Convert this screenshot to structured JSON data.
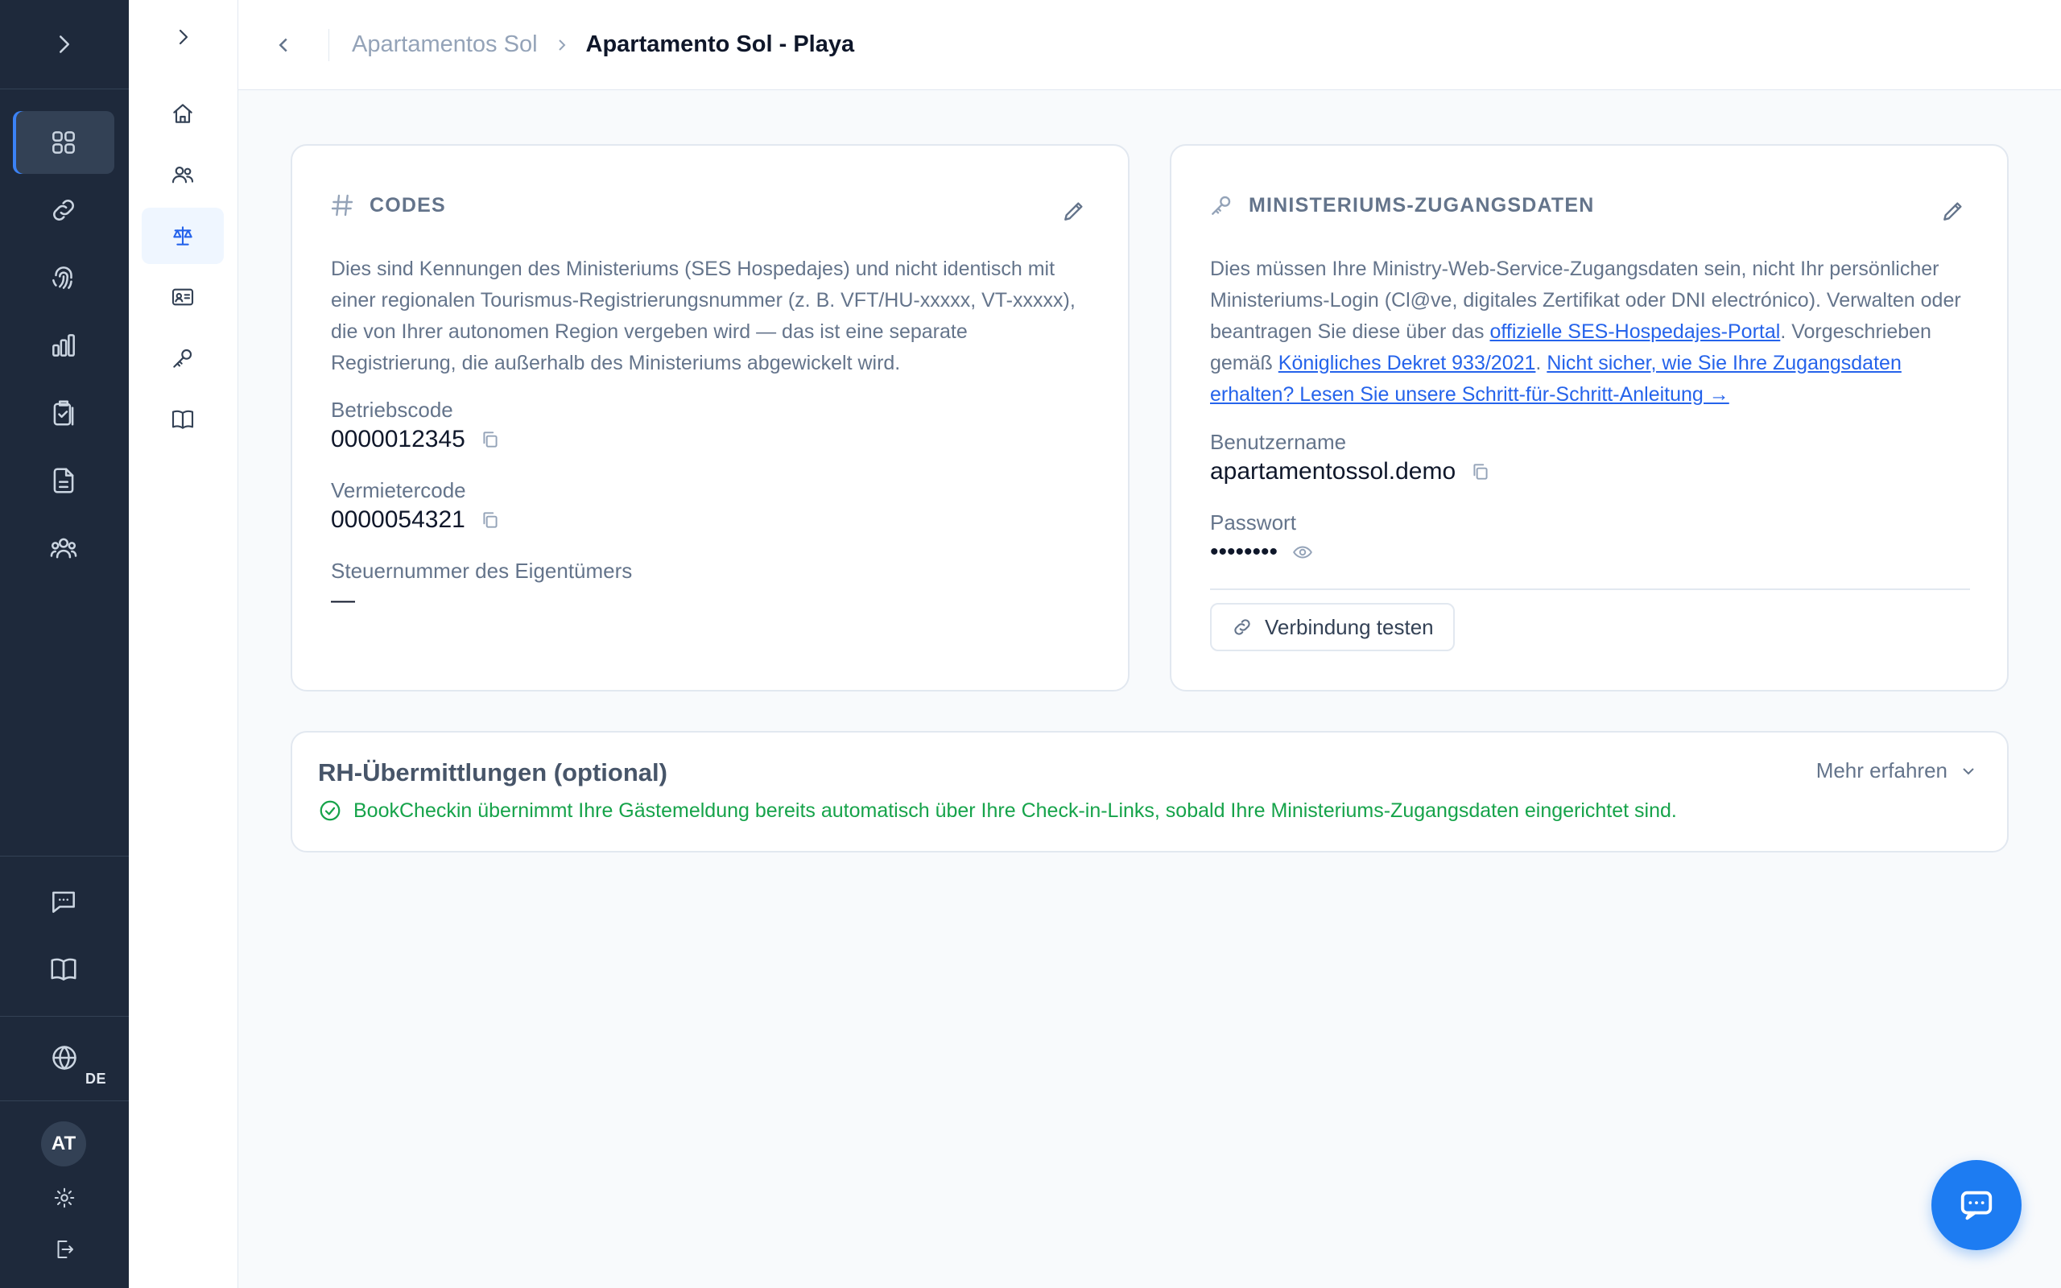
{
  "breadcrumb": {
    "parent": "Apartamentos Sol",
    "current": "Apartamento Sol - Playa"
  },
  "rail": {
    "icons": [
      "chevron-right-icon",
      "dashboard-icon",
      "link-icon",
      "fingerprint-icon",
      "bar-chart-icon",
      "clipboard-check-icon",
      "document-icon",
      "users-group-icon",
      "chat-icon",
      "book-icon",
      "globe-icon",
      "gear-icon",
      "logout-icon"
    ],
    "language": "DE",
    "avatar_initials": "AT",
    "active": "dashboard"
  },
  "subnav": {
    "icons": [
      "chevron-right-icon",
      "home-icon",
      "users-icon",
      "scales-icon",
      "id-card-icon",
      "key-icon",
      "book-icon"
    ],
    "active": "scales"
  },
  "codes_card": {
    "title": "CODES",
    "description": "Dies sind Kennungen des Ministeriums (SES Hospedajes) und nicht identisch mit einer regionalen Tourismus-Registrierungsnummer (z. B. VFT/HU-xxxxx, VT-xxxxx), die von Ihrer autonomen Region vergeben wird — das ist eine separate Registrierung, die außerhalb des Ministeriums abgewickelt wird.",
    "fields": [
      {
        "label": "Betriebscode",
        "value": "0000012345"
      },
      {
        "label": "Vermietercode",
        "value": "0000054321"
      },
      {
        "label": "Steuernummer des Eigentümers",
        "value": "—"
      }
    ]
  },
  "ministry_card": {
    "title": "MINISTERIUMS-ZUGANGSDATEN",
    "desc_part1": "Dies müssen Ihre Ministry-Web-Service-Zugangsdaten sein, nicht Ihr persönlicher Ministeriums-Login (Cl@ve, digitales Zertifikat oder DNI electrónico). Verwalten oder beantragen Sie diese über das ",
    "desc_link1": "offizielle SES-Hospedajes-Portal",
    "desc_part2": ". Vorgeschrieben gemäß ",
    "desc_link2": "Königliches Dekret 933/2021",
    "desc_part3": ". ",
    "desc_link3": "Nicht sicher, wie Sie Ihre Zugangsdaten erhalten? Lesen Sie unsere Schritt-für-Schritt-Anleitung →",
    "username_label": "Benutzername",
    "username_value": "apartamentossol.demo",
    "password_label": "Passwort",
    "password_value": "••••••••",
    "test_button": "Verbindung testen"
  },
  "rh_card": {
    "title": "RH-Übermittlungen (optional)",
    "more_label": "Mehr erfahren",
    "note": "BookCheckin übernimmt Ihre Gästemeldung bereits automatisch über Ihre Check-in-Links, sobald Ihre Ministeriums-Zugangsdaten eingerichtet sind."
  },
  "colors": {
    "rail_bg": "#1e293b",
    "accent": "#2563eb",
    "success": "#16a34a",
    "fab": "#1d7cf2"
  }
}
